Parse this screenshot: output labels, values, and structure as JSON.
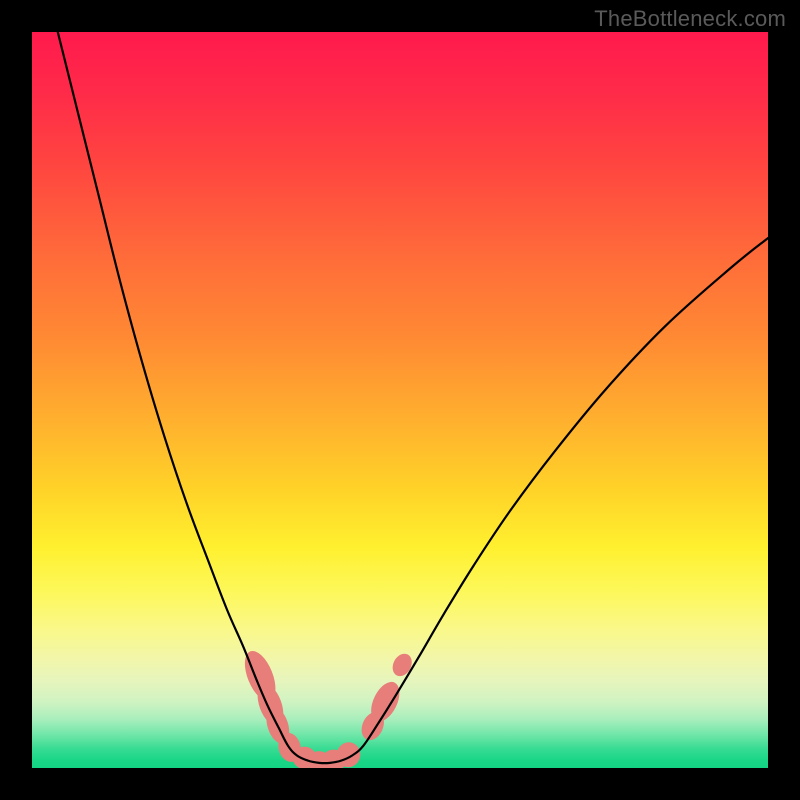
{
  "watermark": "TheBottleneck.com",
  "colors": {
    "frame": "#000000",
    "curve_stroke": "#000000",
    "marker_fill": "#e77e79",
    "marker_stroke": "#e77e79"
  },
  "chart_data": {
    "type": "line",
    "title": "",
    "xlabel": "",
    "ylabel": "",
    "xlim": [
      0,
      100
    ],
    "ylim": [
      0,
      100
    ],
    "grid": false,
    "note": "Axes have no visible tick labels; x/y values are in percent of plot width/height with origin at top-left (y increases downward), estimated from pixel positions.",
    "series": [
      {
        "name": "left-branch",
        "x": [
          3.5,
          6.0,
          9.0,
          12.0,
          15.0,
          18.0,
          21.0,
          24.0,
          26.5,
          28.7,
          30.5,
          32.0,
          33.5,
          34.8
        ],
        "y": [
          0.0,
          10.0,
          22.0,
          34.0,
          45.0,
          55.0,
          64.0,
          72.0,
          78.5,
          83.5,
          88.0,
          91.5,
          94.5,
          97.0
        ]
      },
      {
        "name": "valley",
        "x": [
          34.8,
          36.0,
          37.5,
          39.0,
          40.5,
          42.0,
          43.5,
          45.0
        ],
        "y": [
          97.0,
          98.3,
          99.0,
          99.3,
          99.3,
          99.0,
          98.3,
          97.0
        ]
      },
      {
        "name": "right-branch",
        "x": [
          45.0,
          47.0,
          49.5,
          52.5,
          56.0,
          60.0,
          65.0,
          71.0,
          78.0,
          86.0,
          95.0,
          100.0
        ],
        "y": [
          97.0,
          94.0,
          90.0,
          85.0,
          79.0,
          72.5,
          65.0,
          57.0,
          48.5,
          40.0,
          32.0,
          28.0
        ]
      }
    ],
    "markers": {
      "name": "highlight-dots",
      "note": "salmon capsule/dot markers near the valley floor",
      "points": [
        {
          "x": 31.0,
          "y": 87.5,
          "rx": 1.7,
          "ry": 3.6,
          "rot": -22
        },
        {
          "x": 32.4,
          "y": 91.4,
          "rx": 1.5,
          "ry": 3.0,
          "rot": -20
        },
        {
          "x": 33.4,
          "y": 94.2,
          "rx": 1.4,
          "ry": 2.6,
          "rot": -18
        },
        {
          "x": 35.0,
          "y": 97.2,
          "rx": 1.5,
          "ry": 2.0,
          "rot": -14
        },
        {
          "x": 37.0,
          "y": 98.6,
          "rx": 1.6,
          "ry": 1.5,
          "rot": -6
        },
        {
          "x": 39.0,
          "y": 99.1,
          "rx": 1.6,
          "ry": 1.4,
          "rot": 0
        },
        {
          "x": 41.0,
          "y": 99.0,
          "rx": 1.6,
          "ry": 1.5,
          "rot": 6
        },
        {
          "x": 43.0,
          "y": 98.2,
          "rx": 1.6,
          "ry": 1.7,
          "rot": 12
        },
        {
          "x": 46.3,
          "y": 94.3,
          "rx": 1.4,
          "ry": 2.0,
          "rot": 24
        },
        {
          "x": 48.0,
          "y": 91.0,
          "rx": 1.6,
          "ry": 2.9,
          "rot": 26
        },
        {
          "x": 50.3,
          "y": 86.0,
          "rx": 1.2,
          "ry": 1.6,
          "rot": 28
        }
      ]
    }
  }
}
